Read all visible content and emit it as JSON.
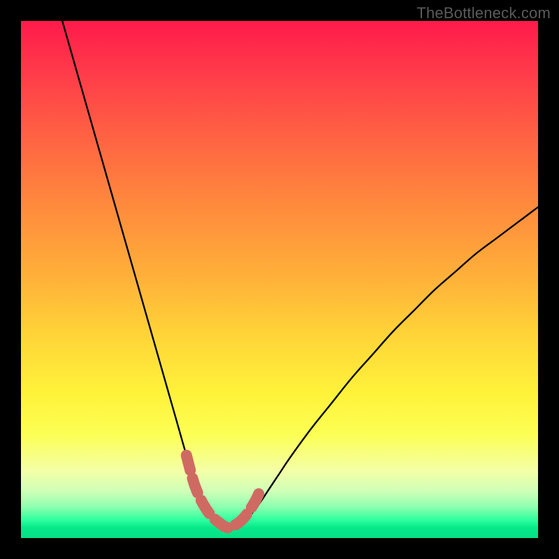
{
  "watermark": "TheBottleneck.com",
  "colors": {
    "frame": "#000000",
    "curve": "#000000",
    "marker": "#cf6a62",
    "gradient_top": "#ff1a4b",
    "gradient_bottom": "#06e186"
  },
  "chart_data": {
    "type": "line",
    "title": "",
    "xlabel": "",
    "ylabel": "",
    "xlim": [
      0,
      100
    ],
    "ylim": [
      0,
      100
    ],
    "grid": false,
    "legend": false,
    "series": [
      {
        "name": "bottleneck-curve",
        "x": [
          8,
          10,
          12,
          14,
          16,
          18,
          20,
          22,
          24,
          26,
          28,
          30,
          32,
          33,
          34,
          35,
          36,
          37,
          38,
          39,
          40,
          41,
          42,
          43,
          44,
          46,
          48,
          50,
          52,
          56,
          60,
          64,
          68,
          72,
          76,
          80,
          84,
          88,
          92,
          96,
          100
        ],
        "y": [
          100,
          93,
          86,
          79,
          72,
          65,
          58,
          51,
          44,
          37,
          30,
          23,
          16,
          13,
          10.5,
          8,
          6,
          4.3,
          3.2,
          2.4,
          2,
          2,
          2.3,
          3,
          4,
          6.5,
          9.5,
          12.5,
          15.5,
          21,
          26,
          31,
          35.5,
          40,
          44,
          48,
          51.5,
          55,
          58,
          61,
          64
        ]
      }
    ],
    "markers": {
      "name": "valley-highlight",
      "x": [
        32.0,
        32.8,
        33.6,
        34.6,
        35.7,
        36.9,
        38.3,
        40.0,
        41.7,
        43.1,
        44.3,
        45.4,
        46.4
      ],
      "y": [
        16.0,
        12.9,
        10.2,
        7.8,
        5.8,
        4.2,
        3.0,
        2.0,
        2.7,
        3.9,
        5.5,
        7.3,
        9.5
      ]
    }
  }
}
